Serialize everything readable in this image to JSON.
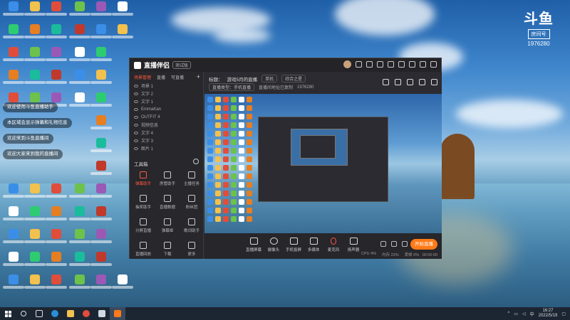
{
  "watermark": {
    "logo": "斗鱼",
    "room_tag": "房间号",
    "room_number": "1976280"
  },
  "chat": [
    {
      "text": "欢迎使用斗鱼直播助手"
    },
    {
      "text": "本区域会显示弹幕和礼物信息"
    },
    {
      "text": "欢迎来到斗鱼直播间"
    },
    {
      "text": "欢迎大家来到我的直播间"
    }
  ],
  "app": {
    "name": "直播伴侣",
    "version": "测试版",
    "tabs": [
      "场景管理",
      "直播",
      "可直播"
    ],
    "scenes": [
      "场景 1",
      "文字 2",
      "文字 1",
      "EmmaKan",
      "OUTFIT 4",
      "视频信息",
      "文字 4",
      "文字 3",
      "图片 1"
    ],
    "tools_title": "工具箱",
    "tools": [
      {
        "label": "弹幕助手",
        "hot": true
      },
      {
        "label": "房管助手",
        "hot": false
      },
      {
        "label": "主播任务",
        "hot": false
      },
      {
        "label": "抽奖助手",
        "hot": false
      },
      {
        "label": "直播数据",
        "hot": false
      },
      {
        "label": "粉丝团",
        "hot": false
      },
      {
        "label": "分屏直播",
        "hot": false
      },
      {
        "label": "弹幕姬",
        "hot": false
      },
      {
        "label": "歌词助手",
        "hot": false
      },
      {
        "label": "直播回放",
        "hot": false
      },
      {
        "label": "下载",
        "hot": false
      },
      {
        "label": "更多",
        "hot": false
      }
    ],
    "title_label": "标题：",
    "room_title": "游戏5月的直播",
    "category_pill": "单机",
    "subcategory_pill": "综合之星",
    "info_row2": [
      "直播类型：手机直播",
      "直播间地址已复制",
      "1976280"
    ],
    "bottom_tools": [
      "直播屏幕",
      "摄像头",
      "手机投屏",
      "多媒体",
      "麦克风",
      "扬声器"
    ],
    "start_button": "开始直播",
    "stats": [
      "CPU 4%",
      "内存 23%",
      "丢帧 0%"
    ],
    "live_time": "00:00:00"
  },
  "taskbar": {
    "time": "16:27",
    "date": "2022/5/19",
    "lang": "中"
  }
}
